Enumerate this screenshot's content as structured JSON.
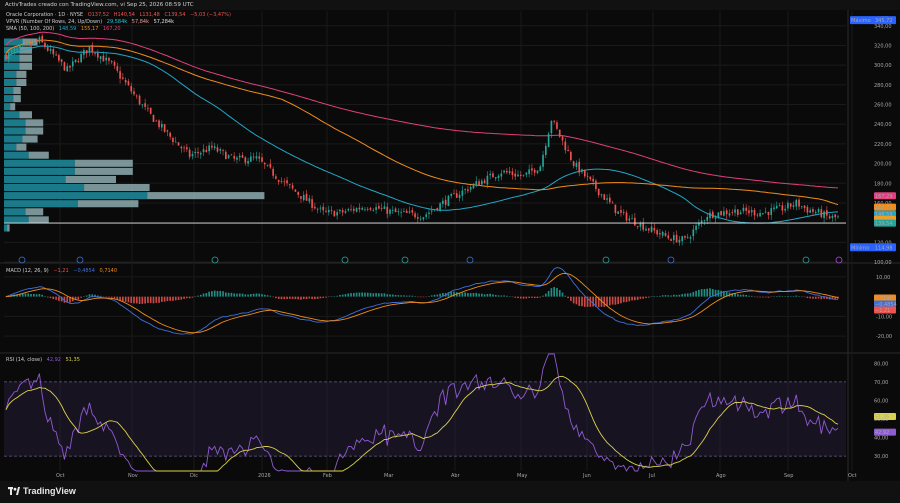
{
  "header": {
    "credit": "ActivTrades creado con TradingView.com, vi Sep 25, 2026 08:59 UTC"
  },
  "legend": {
    "main": [
      "Oracle Corporation · 1D · NYSE",
      "O137,52",
      "H140,54",
      "L131,48",
      "C139,54",
      "−5,03 (−3,47%)"
    ],
    "vpvr": [
      "VPVR (Number Of Rows, 24, Up/Down)",
      "29,584k",
      "57,84k",
      "57,284k"
    ],
    "sma": [
      "SMA (50, 100, 200)",
      "148,59",
      "155,17",
      "167,20"
    ],
    "macd": [
      "MACD (12, 26, 9)",
      "−1,21",
      "−0,4854",
      "0,7140"
    ],
    "rsi": [
      "RSI (14, close)",
      "42,92",
      "51,35"
    ]
  },
  "currency": "USD",
  "footer": {
    "brand": "TradingView"
  },
  "colors": {
    "bull": "#26a69a",
    "bear": "#ef5350",
    "sma50": "#22a7c7",
    "sma100": "#f08c1c",
    "sma200": "#e0407d",
    "macd": "#3f6fd8",
    "signal": "#f08c1c",
    "rsi": "#8e5bd1",
    "rsiMa": "#d9d24a"
  },
  "chart_data": [
    {
      "type": "candlestick",
      "ylim": [
        100,
        355
      ],
      "y_ticks": [
        100,
        120,
        140,
        160,
        180,
        200,
        220,
        240,
        260,
        280,
        300,
        320,
        340
      ],
      "x_ticks": [
        "Oct",
        "Nov",
        "Dic",
        "2026",
        "Feb",
        "Mar",
        "Abr",
        "May",
        "Jun",
        "Jul",
        "Ago",
        "Sep",
        "Oct"
      ],
      "close_anchors": [
        [
          0,
          310
        ],
        [
          12,
          325
        ],
        [
          22,
          295
        ],
        [
          30,
          318
        ],
        [
          38,
          300
        ],
        [
          42,
          285
        ],
        [
          50,
          255
        ],
        [
          58,
          230
        ],
        [
          66,
          208
        ],
        [
          74,
          216
        ],
        [
          82,
          204
        ],
        [
          90,
          205
        ],
        [
          100,
          180
        ],
        [
          108,
          163
        ],
        [
          114,
          150
        ],
        [
          120,
          150
        ],
        [
          130,
          157
        ],
        [
          140,
          150
        ],
        [
          150,
          147
        ],
        [
          158,
          162
        ],
        [
          168,
          178
        ],
        [
          178,
          192
        ],
        [
          186,
          187
        ],
        [
          192,
          198
        ],
        [
          196,
          245
        ],
        [
          204,
          200
        ],
        [
          212,
          175
        ],
        [
          220,
          150
        ],
        [
          230,
          135
        ],
        [
          238,
          125
        ],
        [
          244,
          122
        ],
        [
          252,
          148
        ],
        [
          262,
          152
        ],
        [
          272,
          150
        ],
        [
          280,
          155
        ],
        [
          284,
          160
        ],
        [
          288,
          153
        ],
        [
          292,
          150
        ],
        [
          296,
          145
        ]
      ],
      "labels": [
        {
          "value": "345,72",
          "text": "Máximo",
          "price": 345.72
        },
        {
          "value": "167,29",
          "price": 167.29
        },
        {
          "value": "155,73",
          "price": 155.73
        },
        {
          "value": "148,59",
          "price": 148.59
        },
        {
          "value": "143,25",
          "price": 143.25
        },
        {
          "value": "139,54",
          "price": 139.54
        },
        {
          "value": "114,98",
          "text": "Mínimo",
          "price": 114.98
        }
      ],
      "volume_profile": [
        0.12,
        0.1,
        0.1,
        0.1,
        0.08,
        0.08,
        0.06,
        0.06,
        0.04,
        0.1,
        0.14,
        0.14,
        0.12,
        0.08,
        0.16,
        0.46,
        0.46,
        0.4,
        0.52,
        0.93,
        0.48,
        0.14,
        0.16,
        0.02
      ]
    },
    {
      "type": "line",
      "name": "MACD",
      "ylim": [
        -28,
        16
      ],
      "y_ticks": [
        -20,
        -10,
        10
      ],
      "labels": [
        {
          "value": "0,7140",
          "price": 0.714
        },
        {
          "value": "−0,4854",
          "price": -0.4854
        },
        {
          "value": "−1,21",
          "price": -1.21
        }
      ]
    },
    {
      "type": "line",
      "name": "RSI",
      "ylim": [
        22,
        85
      ],
      "y_ticks": [
        30,
        40,
        50,
        60,
        70,
        80
      ],
      "bands": [
        30,
        70
      ],
      "labels": [
        {
          "value": "51,35",
          "price": 51.35
        },
        {
          "value": "42,92",
          "price": 42.92
        }
      ]
    }
  ]
}
